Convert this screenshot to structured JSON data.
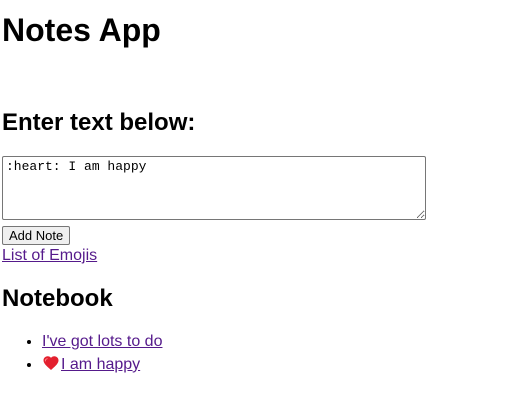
{
  "app": {
    "title": "Notes App"
  },
  "editor": {
    "heading": "Enter text below:",
    "textarea_value": ":heart: I am happy",
    "add_button_label": "Add Note"
  },
  "links": {
    "emoji_list": "List of Emojis"
  },
  "notebook": {
    "heading": "Notebook",
    "notes": [
      {
        "text": "I've got lots to do"
      },
      {
        "text": "I am happy",
        "emoji": "heart-icon"
      }
    ]
  },
  "colors": {
    "visited_link": "#551a8b",
    "heart": "#e3202f"
  }
}
